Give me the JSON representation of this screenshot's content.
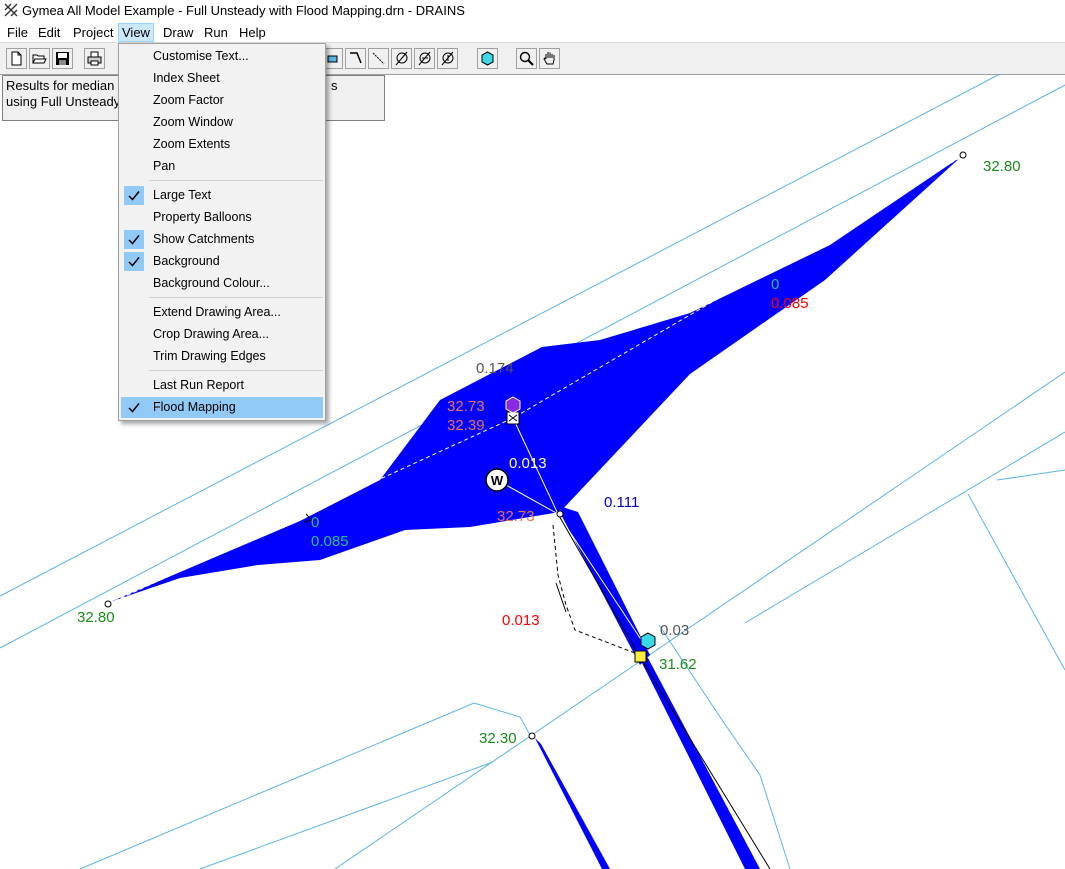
{
  "window": {
    "title": "Gymea All Model Example - Full Unsteady with Flood Mapping.drn - DRAINS"
  },
  "menubar": [
    "File",
    "Edit",
    "Project",
    "View",
    "Draw",
    "Run",
    "Help"
  ],
  "active_menu": "View",
  "info_box": {
    "line1": "Results for median",
    "line1_tail": "s",
    "line2": "using Full Unsteady"
  },
  "view_menu": {
    "customise_text": "Customise Text...",
    "index_sheet": "Index Sheet",
    "zoom_factor": "Zoom Factor",
    "zoom_window": "Zoom Window",
    "zoom_extents": "Zoom Extents",
    "pan": "Pan",
    "large_text": "Large Text",
    "property_balloons": "Property Balloons",
    "show_catchments": "Show Catchments",
    "background": "Background",
    "background_colour": "Background Colour...",
    "extend_drawing_area": "Extend Drawing Area...",
    "crop_drawing_area": "Crop Drawing Area...",
    "trim_drawing_edges": "Trim Drawing Edges",
    "last_run_report": "Last Run Report",
    "flood_mapping": "Flood Mapping",
    "checked": [
      "Large Text",
      "Show Catchments",
      "Background",
      "Flood Mapping"
    ],
    "highlighted": "Flood Mapping"
  },
  "map_labels": {
    "top_right_elev": "32.80",
    "right_flow_0": "0",
    "right_flow_red": "0.085",
    "center_flow": "0.174",
    "pit_hgl_1": "32.73",
    "pit_hgl_2": "32.39",
    "pipe_flow_center": "0.013",
    "junction_hgl": "32.73",
    "blue_flow": "0.111",
    "left_flow_0": "0",
    "left_flow": "0.085",
    "left_elev": "32.80",
    "overflow_red": "0.013",
    "pit2_flow": "0.03",
    "pit2_elev": "31.62",
    "bottom_elev": "32.30"
  },
  "colors": {
    "flood": "#0000ff",
    "property_lines": "#5ab4e8",
    "elev_label": "#1a8c1a",
    "flow_green": "#22c080",
    "hgl_label": "#e8705a",
    "overflow_red": "#ff0000",
    "menu_highlight": "#91c9f7"
  },
  "icons": [
    "new-file-icon",
    "open-folder-icon",
    "save-icon",
    "print-icon",
    "node-tool-icon",
    "link-tool-icon",
    "pipe-tool-icon",
    "pit-tool-icon",
    "pit-tool-2-icon",
    "pit-tool-3-icon",
    "catchment-hex-icon",
    "zoom-icon",
    "pan-hand-icon"
  ]
}
